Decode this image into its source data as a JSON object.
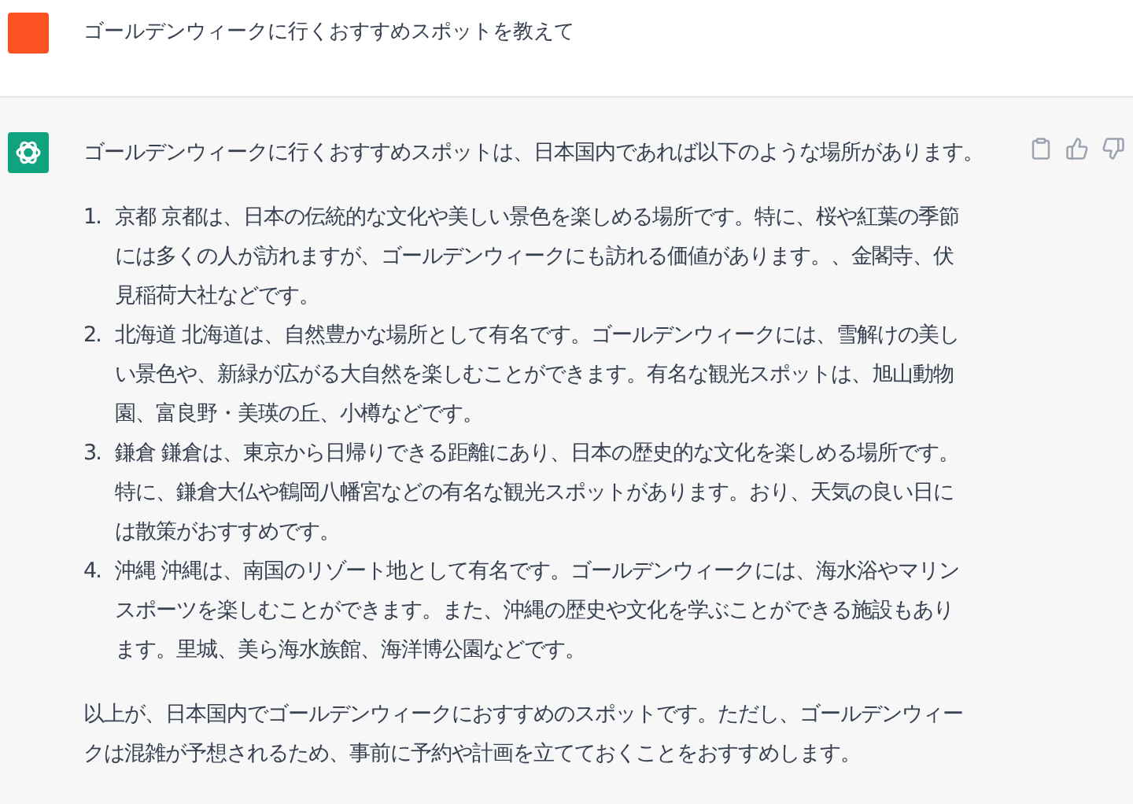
{
  "user": {
    "message": "ゴールデンウィークに行くおすすめスポットを教えて"
  },
  "assistant": {
    "intro": "ゴールデンウィークに行くおすすめスポットは、日本国内であれば以下のような場所があります。",
    "items": [
      {
        "number": "1.",
        "text": "京都 京都は、日本の伝統的な文化や美しい景色を楽しめる場所です。特に、桜や紅葉の季節には多くの人が訪れますが、ゴールデンウィークにも訪れる価値があります。、金閣寺、伏見稲荷大社などです。"
      },
      {
        "number": "2.",
        "text": "北海道 北海道は、自然豊かな場所として有名です。ゴールデンウィークには、雪解けの美しい景色や、新緑が広がる大自然を楽しむことができます。有名な観光スポットは、旭山動物園、富良野・美瑛の丘、小樽などです。"
      },
      {
        "number": "3.",
        "text": "鎌倉 鎌倉は、東京から日帰りできる距離にあり、日本の歴史的な文化を楽しめる場所です。特に、鎌倉大仏や鶴岡八幡宮などの有名な観光スポットがあります。おり、天気の良い日には散策がおすすめです。"
      },
      {
        "number": "4.",
        "text": "沖縄 沖縄は、南国のリゾート地として有名です。ゴールデンウィークには、海水浴やマリンスポーツを楽しむことができます。また、沖縄の歴史や文化を学ぶことができる施設もあります。里城、美ら海水族館、海洋博公園などです。"
      }
    ],
    "outro": "以上が、日本国内でゴールデンウィークにおすすめのスポットです。ただし、ゴールデンウィークは混雑が予想されるため、事前に予約や計画を立てておくことをおすすめします。"
  }
}
